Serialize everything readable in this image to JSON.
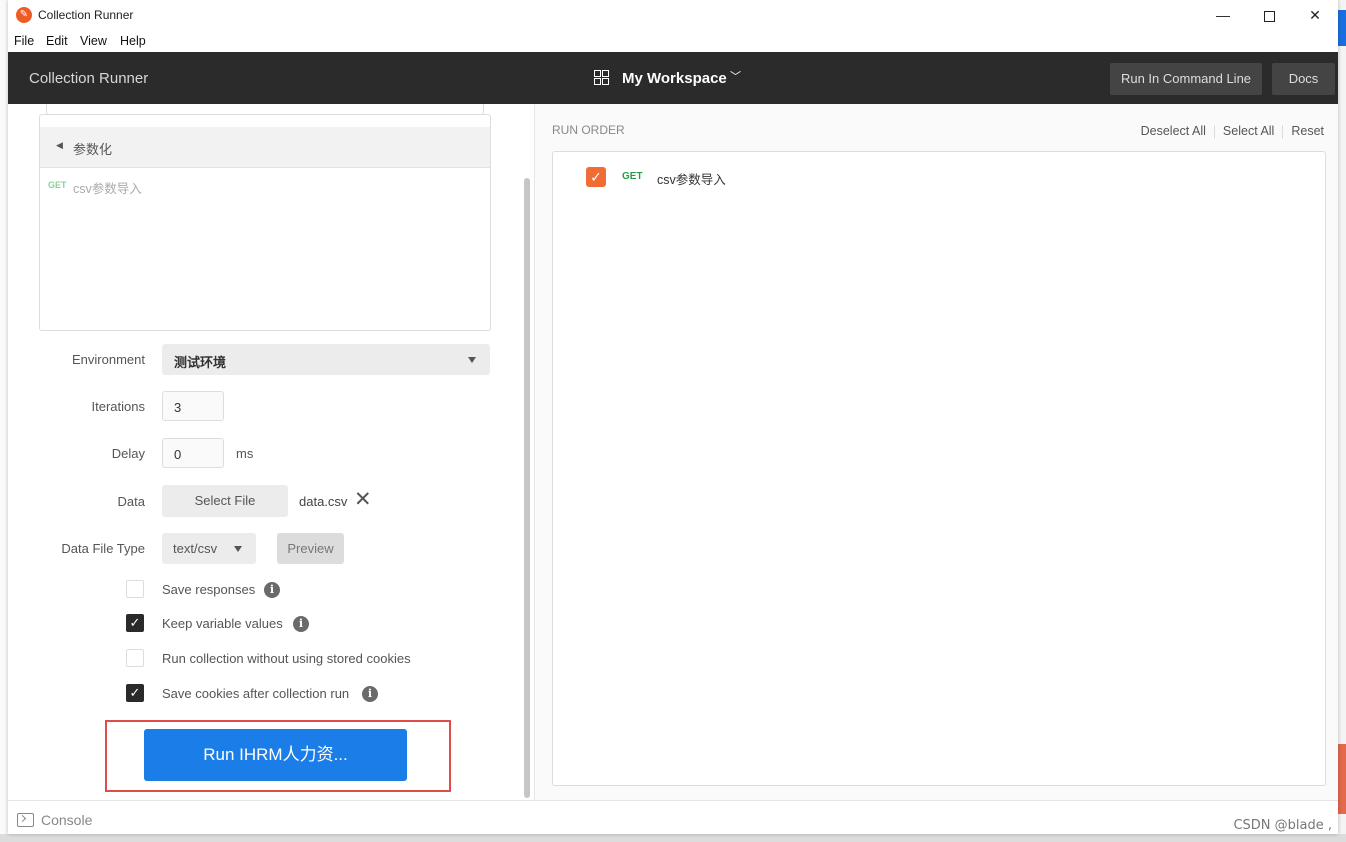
{
  "window": {
    "title": "Collection Runner",
    "minimize": "—",
    "close": "✕"
  },
  "menu": [
    "File",
    "Edit",
    "View",
    "Help"
  ],
  "header": {
    "title": "Collection Runner",
    "workspace": "My Workspace",
    "run_cmd_label": "Run In Command Line",
    "docs_label": "Docs"
  },
  "collection": {
    "folder": "参数化",
    "requests": [
      {
        "method": "GET",
        "name": "csv参数导入"
      }
    ]
  },
  "form": {
    "environment_label": "Environment",
    "environment_value": "测试环境",
    "iterations_label": "Iterations",
    "iterations_value": "3",
    "delay_label": "Delay",
    "delay_value": "0",
    "delay_unit": "ms",
    "data_label": "Data",
    "select_file_label": "Select File",
    "file_name": "data.csv",
    "data_file_type_label": "Data File Type",
    "data_file_type_value": "text/csv",
    "preview_label": "Preview",
    "options": [
      {
        "label": "Save responses",
        "checked": false,
        "info": true
      },
      {
        "label": "Keep variable values",
        "checked": true,
        "info": true
      },
      {
        "label": "Run collection without using stored cookies",
        "checked": false,
        "info": false
      },
      {
        "label": "Save cookies after collection run",
        "checked": true,
        "info": true
      }
    ],
    "run_button": "Run IHRM人力资..."
  },
  "run_order": {
    "title": "RUN ORDER",
    "deselect_all": "Deselect All",
    "select_all": "Select All",
    "reset": "Reset",
    "items": [
      {
        "method": "GET",
        "name": "csv参数导入",
        "checked": true
      }
    ]
  },
  "footer": {
    "console_label": "Console"
  },
  "watermark": "CSDN @blade ,",
  "colors": {
    "header_bg": "#2b2b2b",
    "run_button": "#1a7de8",
    "run_order_check": "#ef6c35",
    "method_get": "#2a9c47",
    "highlight": "#e04b4b"
  }
}
